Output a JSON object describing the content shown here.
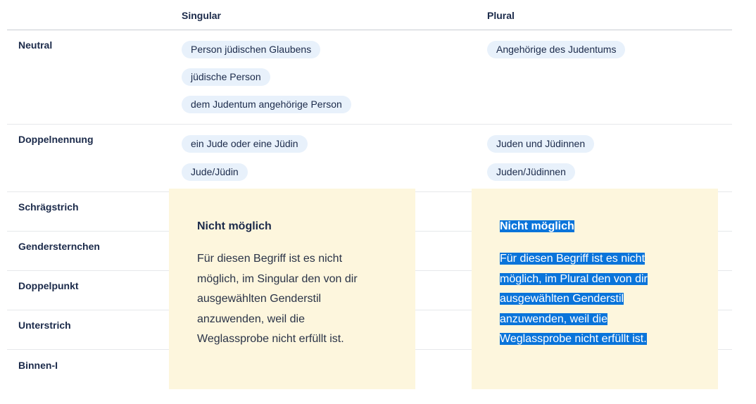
{
  "table": {
    "headers": {
      "singular": "Singular",
      "plural": "Plural"
    },
    "rows": [
      {
        "label": "Neutral",
        "singular": [
          "Person jüdischen Glaubens",
          "jüdische Person",
          "dem Judentum angehörige Person"
        ],
        "plural": [
          "Angehörige des Judentums"
        ]
      },
      {
        "label": "Doppelnennung",
        "singular": [
          "ein Jude oder eine Jüdin",
          "Jude/Jüdin"
        ],
        "plural": [
          "Juden und Jüdinnen",
          "Juden/Jüdinnen"
        ]
      },
      {
        "label": "Schrägstrich"
      },
      {
        "label": "Gendersternchen"
      },
      {
        "label": "Doppelpunkt"
      },
      {
        "label": "Unterstrich"
      },
      {
        "label": "Binnen-I"
      }
    ]
  },
  "notices": {
    "singular": {
      "title": "Nicht möglich",
      "lines": [
        "Für diesen Begriff ist es nicht",
        "möglich, im Singular den von dir",
        "ausgewählten Genderstil",
        "anzuwenden, weil die",
        "Weglassprobe nicht erfüllt ist."
      ]
    },
    "plural": {
      "title": "Nicht möglich",
      "lines": [
        "Für diesen Begriff ist es nicht",
        "möglich, im Plural den von dir",
        "ausgewählten Genderstil",
        "anzuwenden, weil die",
        "Weglassprobe nicht erfüllt ist."
      ]
    }
  },
  "colors": {
    "chip_bg": "#e8f1fb",
    "notice_bg": "#fdf6dd",
    "selection": "#0a74da",
    "text": "#1b2a4a"
  }
}
